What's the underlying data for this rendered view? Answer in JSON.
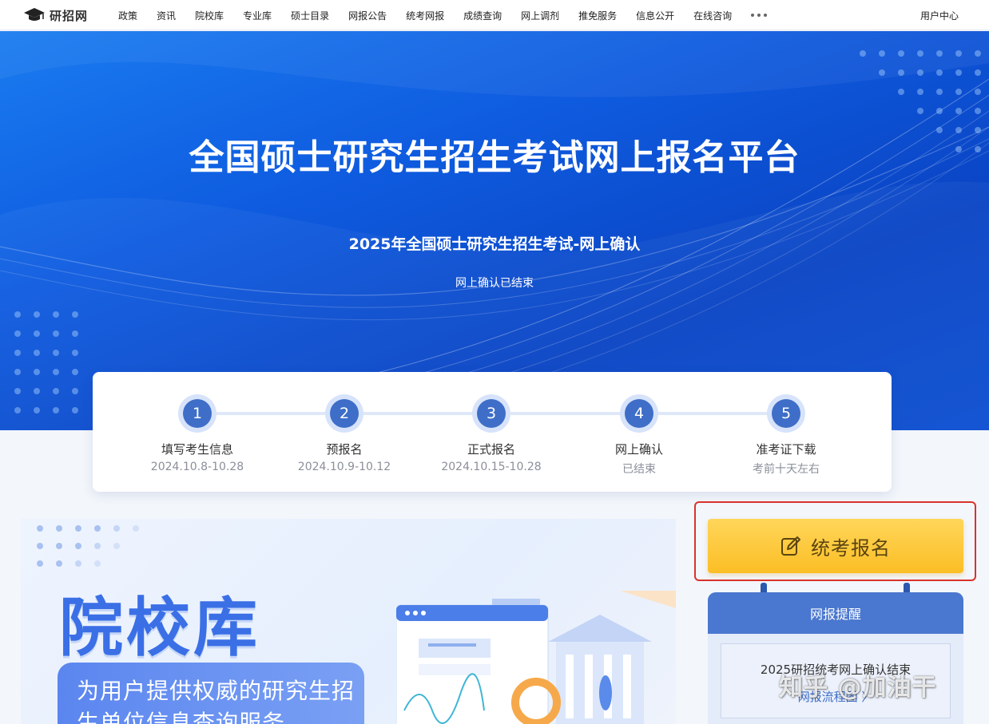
{
  "header": {
    "logo_text": "研招网",
    "nav": [
      "政策",
      "资讯",
      "院校库",
      "专业库",
      "硕士目录",
      "网报公告",
      "统考网报",
      "成绩查询",
      "网上调剂",
      "推免服务",
      "信息公开",
      "在线咨询"
    ],
    "user_center": "用户中心"
  },
  "hero": {
    "title": "全国硕士研究生招生考试网上报名平台",
    "subtitle": "2025年全国硕士研究生招生考试-网上确认",
    "status": "网上确认已结束"
  },
  "steps": [
    {
      "num": "1",
      "name": "填写考生信息",
      "date": "2024.10.8-10.28"
    },
    {
      "num": "2",
      "name": "预报名",
      "date": "2024.10.9-10.12"
    },
    {
      "num": "3",
      "name": "正式报名",
      "date": "2024.10.15-10.28"
    },
    {
      "num": "4",
      "name": "网上确认",
      "date": "已结束"
    },
    {
      "num": "5",
      "name": "准考证下载",
      "date": "考前十天左右"
    }
  ],
  "library": {
    "title": "院校库",
    "desc": "为用户提供权威的研究生招生单位信息查询服务"
  },
  "apply_button": {
    "label": "统考报名",
    "icon": "edit-icon"
  },
  "reminder": {
    "title": "网报提醒",
    "text": "2025研招统考网上确认结束",
    "link": "网报流程图 〉"
  },
  "watermark": "知乎 @加油干",
  "colors": {
    "primary": "#3e6ec8",
    "hero": "#0f5ce0",
    "button": "#fbbe25",
    "highlight": "#d8332b"
  }
}
